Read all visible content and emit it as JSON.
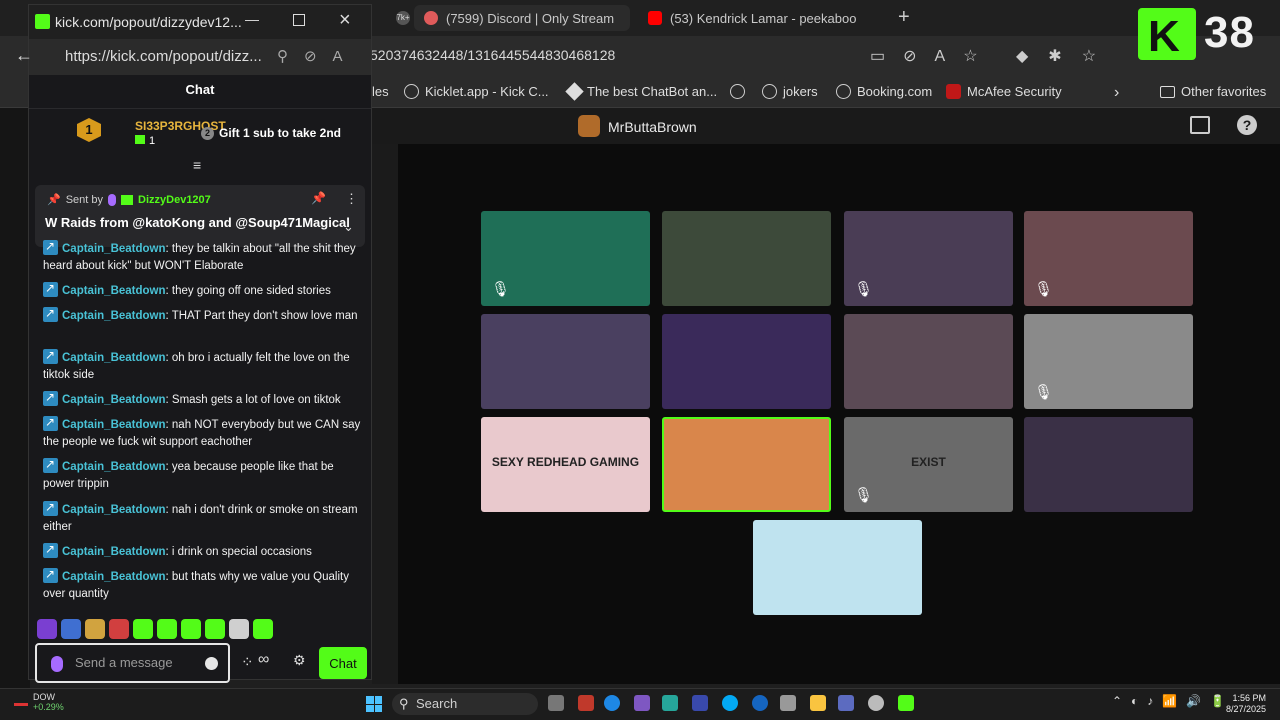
{
  "bg_browser": {
    "tabs": [
      {
        "label": "(7599) Discord | Only Stream",
        "color": "#e05b5b"
      },
      {
        "label": "(53) Kendrick Lamar - peekaboo",
        "color": "#ff0000"
      }
    ],
    "url": "520374632448/1316445544830468128",
    "bookmarks": [
      "les",
      "Kicklet.app - Kick C...",
      "The best ChatBot an...",
      "jokers",
      "Booking.com",
      "McAfee Security"
    ],
    "other_favorites": "Other favorites",
    "tab_badge": "7k+"
  },
  "kick_overlay": {
    "viewer_count": "38",
    "logo_letter": "K",
    "brand_color": "#53fc18"
  },
  "stream": {
    "streamer": "MrButtaBrown",
    "tiles": [
      {
        "color": "#1f6f57",
        "muted": true
      },
      {
        "color": "#3d4a3a",
        "muted": false
      },
      {
        "color": "#4a3d55",
        "muted": true
      },
      {
        "color": "#6b4a4f",
        "muted": true
      },
      {
        "color": "#4a4060",
        "muted": false
      },
      {
        "color": "#3a2a5a",
        "muted": false
      },
      {
        "color": "#5b4a55",
        "muted": false
      },
      {
        "color": "#8a8a8a",
        "muted": true
      },
      {
        "color": "#e9c9cd",
        "muted": false,
        "label": "SEXY REDHEAD GAMING"
      },
      {
        "color": "#d9864b",
        "muted": false,
        "highlight": true
      },
      {
        "color": "#6a6a6a",
        "muted": true,
        "label": "EXIST"
      },
      {
        "color": "#3a3046",
        "muted": false
      },
      {
        "color": "#bfe3ef",
        "muted": false
      }
    ]
  },
  "popout": {
    "title": "kick.com/popout/dizzydev12...",
    "url": "https://kick.com/popout/dizz...",
    "chat_header": "Chat",
    "leaderboard": {
      "rank": "1",
      "name": "SI33P3RGHOST",
      "count": "1",
      "gift_text": "Gift 1 sub to take 2nd",
      "gift_icon": "2"
    },
    "pinned": {
      "sent_by": "Sent by",
      "user": "DizzyDev1207",
      "message": "W Raids from @katoKong and @Soup471Magical"
    },
    "messages": [
      {
        "user": "Captain_Beatdown",
        "text": "they be talkin about \"all the shit they heard about kick\" but WON'T Elaborate"
      },
      {
        "user": "Captain_Beatdown",
        "text": "they going off one sided stories"
      },
      {
        "user": "Captain_Beatdown",
        "text": "THAT Part they don't show love man"
      },
      {
        "user": "Captain_Beatdown",
        "text": "oh bro i actually felt the love on the tiktok side"
      },
      {
        "user": "Captain_Beatdown",
        "text": "Smash gets a lot of love on tiktok"
      },
      {
        "user": "Captain_Beatdown",
        "text": "nah NOT everybody but we CAN say the people we fuck wit support eachother"
      },
      {
        "user": "Captain_Beatdown",
        "text": "yea because people like that be power trippin"
      },
      {
        "user": "Captain_Beatdown",
        "text": "nah i don't drink or smoke on stream either"
      },
      {
        "user": "Captain_Beatdown",
        "text": "i drink on special occasions"
      },
      {
        "user": "Captain_Beatdown",
        "text": "but thats why we value you Quality over quantity"
      }
    ],
    "input_placeholder": "Send a message",
    "chat_button": "Chat",
    "emotes": [
      "#7a3fd1",
      "#3f6fd1",
      "#d1a33f",
      "#d13f3f",
      "#53fc18",
      "#53fc18",
      "#53fc18",
      "#53fc18",
      "#cfcfcf",
      "#53fc18"
    ]
  },
  "taskbar": {
    "search": "Search",
    "ticker": "DOW",
    "change": "+0.29%",
    "time": "1:56 PM",
    "date": "8/27/2025"
  }
}
